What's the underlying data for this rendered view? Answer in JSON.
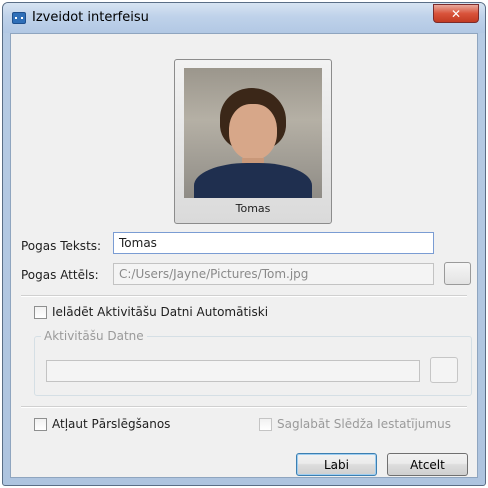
{
  "window": {
    "title": "Izveidot interfeisu",
    "close_glyph": "✕",
    "icon": "app-icon"
  },
  "avatar": {
    "name": "Tomas"
  },
  "button_text": {
    "label": "Pogas Teksts:",
    "value": "Tomas"
  },
  "button_image": {
    "label": "Pogas Attēls:",
    "value": "C:/Users/Jayne/Pictures/Tom.jpg",
    "browse_label": ""
  },
  "auto_load": {
    "label": "Ielādēt Aktivitāšu Datni Automātiski",
    "checked": false
  },
  "activity_file": {
    "group_title": "Aktivitāšu Datne",
    "value": "",
    "browse_label": ""
  },
  "allow_switching": {
    "label": "Atļaut Pārslēgšanos",
    "checked": false
  },
  "save_switch_settings": {
    "label": "Saglabāt Slēdža Iestatījumus",
    "checked": false,
    "enabled": false
  },
  "buttons": {
    "ok": "Labi",
    "cancel": "Atcelt"
  }
}
